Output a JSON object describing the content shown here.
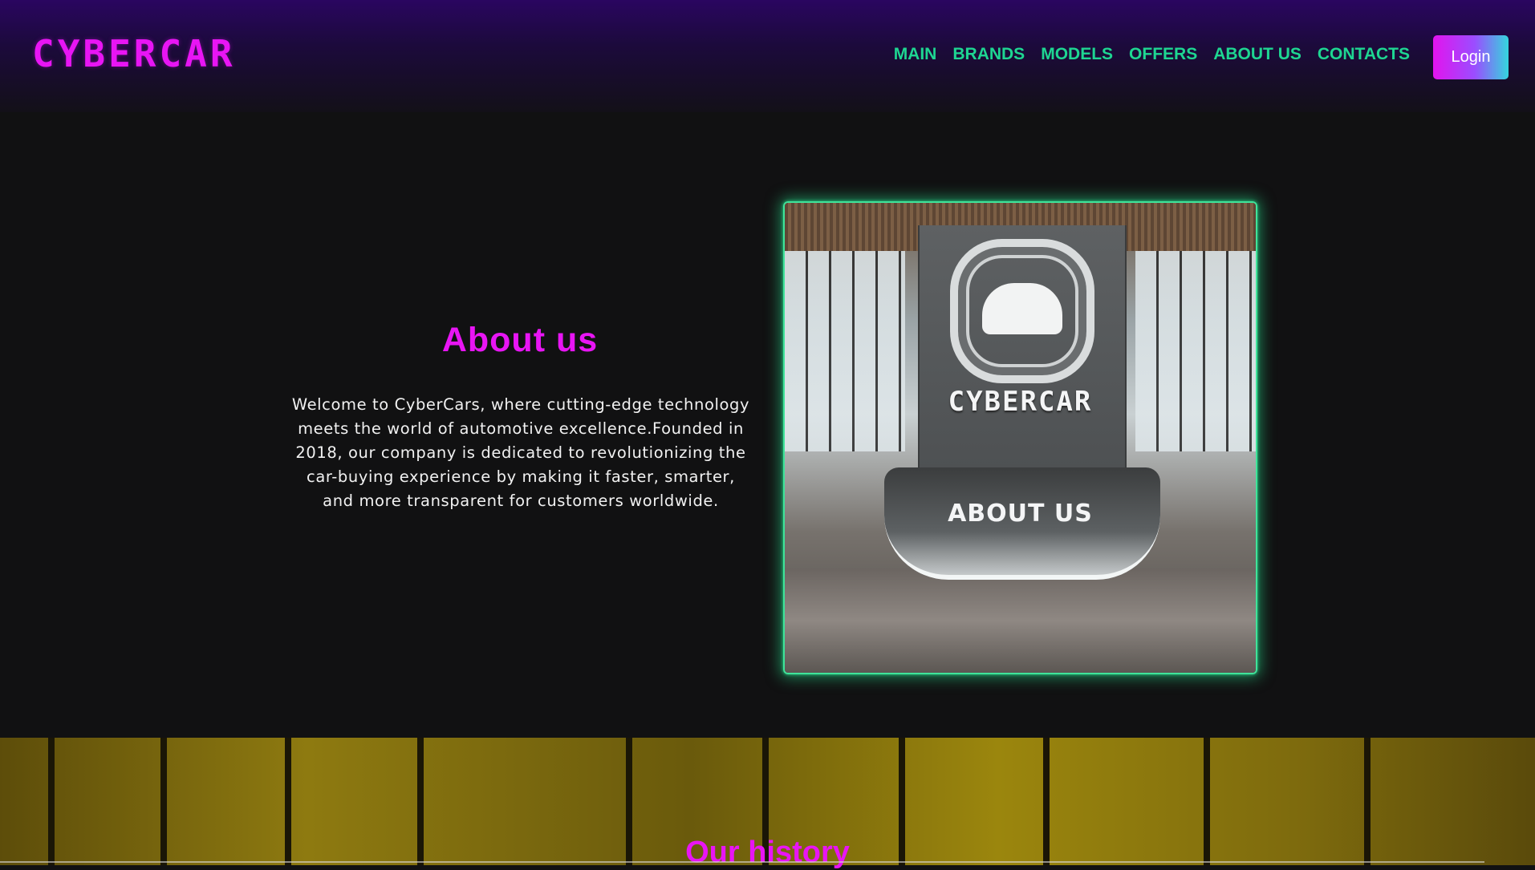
{
  "header": {
    "logo": "CYBERCAR",
    "nav": [
      "MAIN",
      "BRANDS",
      "MODELS",
      "OFFERS",
      "ABOUT US",
      "CONTACTS"
    ],
    "login_label": "Login"
  },
  "about": {
    "title": "About us",
    "text": "Welcome to CyberCars, where cutting-edge technology meets the world of automotive excellence.Founded in 2018, our company is dedicated to revolutionizing the car-buying experience by making it faster, smarter, and more transparent for customers worldwide.",
    "image_brand": "CYBERCAR",
    "image_label": "ABOUT US"
  },
  "history": {
    "title": "Our history"
  },
  "colors": {
    "accent_magenta": "#e815f4",
    "nav_green": "#1ed692",
    "glow_green": "#3fe39a",
    "background": "#111112"
  }
}
